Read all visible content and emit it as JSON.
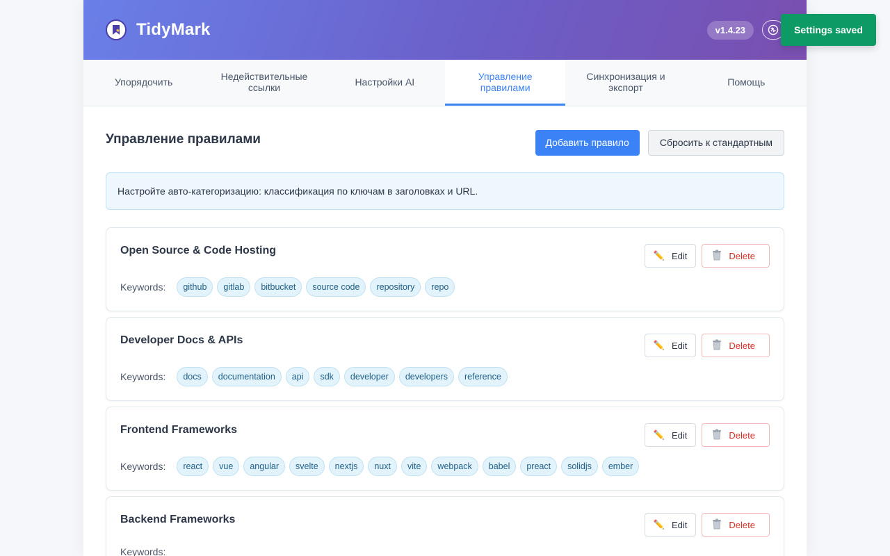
{
  "header": {
    "brand": "TidyMark",
    "version": "v1.4.23",
    "lang_icon": "translate-icon"
  },
  "tabs": [
    {
      "label": "Упорядочить"
    },
    {
      "label": "Недействительные ссылки"
    },
    {
      "label": "Настройки AI"
    },
    {
      "label": "Управление правилами",
      "active": true
    },
    {
      "label": "Синхронизация и экспорт"
    },
    {
      "label": "Помощь"
    }
  ],
  "section": {
    "title": "Управление правилами",
    "add_label": "Добавить правило",
    "reset_label": "Сбросить к стандартным",
    "info": "Настройте авто-категоризацию: классификация по ключам в заголовках и URL."
  },
  "rule_labels": {
    "keywords": "Keywords:",
    "edit": "Edit",
    "delete": "Delete"
  },
  "rules": [
    {
      "title": "Open Source & Code Hosting",
      "keywords": [
        "github",
        "gitlab",
        "bitbucket",
        "source code",
        "repository",
        "repo"
      ]
    },
    {
      "title": "Developer Docs & APIs",
      "keywords": [
        "docs",
        "documentation",
        "api",
        "sdk",
        "developer",
        "developers",
        "reference"
      ]
    },
    {
      "title": "Frontend Frameworks",
      "keywords": [
        "react",
        "vue",
        "angular",
        "svelte",
        "nextjs",
        "nuxt",
        "vite",
        "webpack",
        "babel",
        "preact",
        "solidjs",
        "ember"
      ]
    },
    {
      "title": "Backend Frameworks",
      "keywords": []
    }
  ],
  "toast": "Settings saved",
  "colors": {
    "accent": "#3b82f6",
    "toast": "#0e9a64",
    "delete": "#d93025",
    "header_start": "#6a7fe8",
    "header_end": "#7a4fb0"
  }
}
